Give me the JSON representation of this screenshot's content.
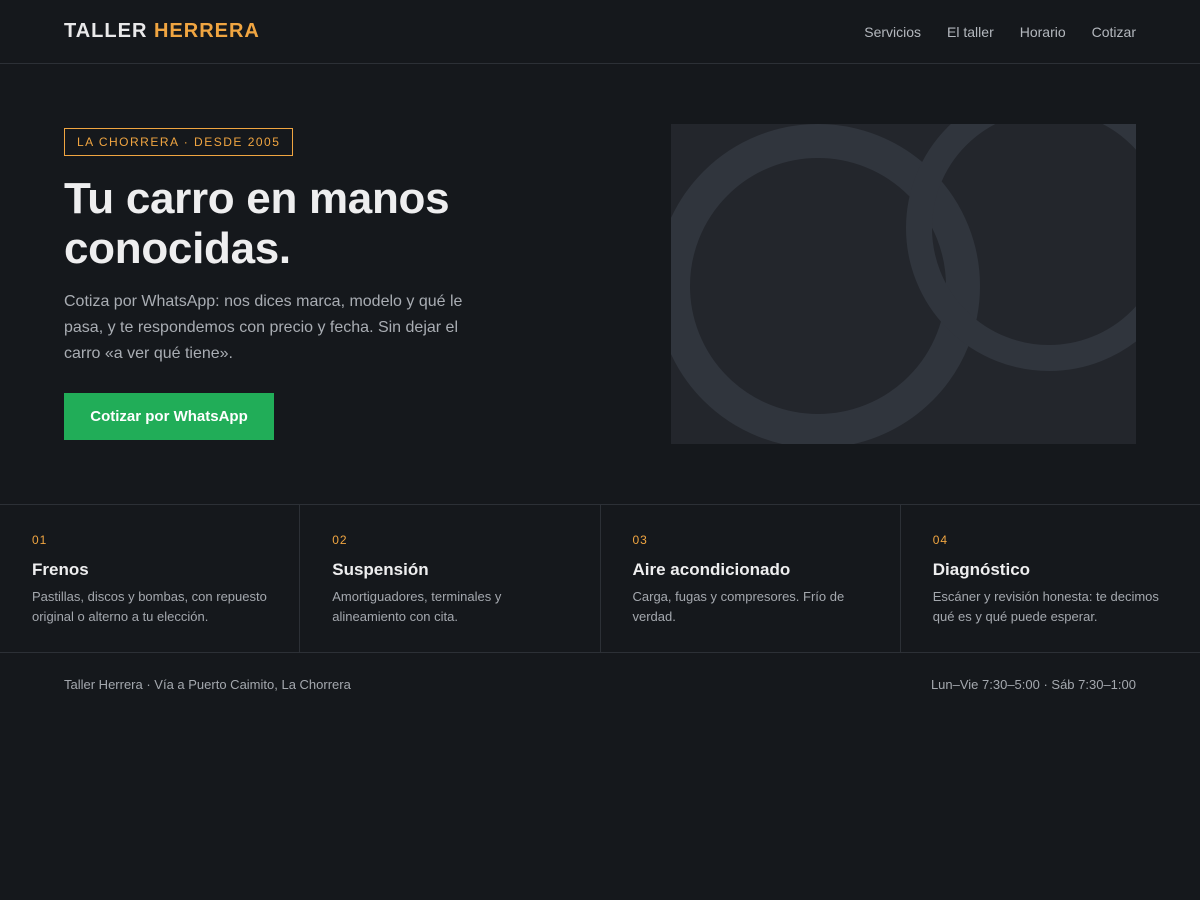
{
  "brand": {
    "part1": "TALLER",
    "part2": "HERRERA"
  },
  "nav": {
    "items": [
      "Servicios",
      "El taller",
      "Horario",
      "Cotizar"
    ]
  },
  "hero": {
    "tag": "LA CHORRERA · DESDE 2005",
    "title": "Tu carro en manos conocidas.",
    "text": "Cotiza por WhatsApp: nos dices marca, modelo y qué le pasa, y te respondemos con precio y fecha. Sin dejar el carro «a ver qué tiene».",
    "cta_label": "Cotizar por WhatsApp"
  },
  "services": [
    {
      "num": "01",
      "title": "Frenos",
      "desc": "Pastillas, discos y bombas, con repuesto original o alterno a tu elección."
    },
    {
      "num": "02",
      "title": "Suspensión",
      "desc": "Amortiguadores, terminales y alineamiento con cita."
    },
    {
      "num": "03",
      "title": "Aire acondicionado",
      "desc": "Carga, fugas y compresores. Frío de verdad."
    },
    {
      "num": "04",
      "title": "Diagnóstico",
      "desc": "Escáner y revisión honesta: te decimos qué es y qué puede esperar."
    }
  ],
  "footer": {
    "address": "Taller Herrera · Vía a Puerto Caimito, La Chorrera",
    "hours": "Lun–Vie 7:30–5:00 · Sáb 7:30–1:00"
  },
  "colors": {
    "background": "#15181c",
    "accent": "#f0a541",
    "cta": "#21ad58",
    "art_panel": "#23262c",
    "art_ring": "#30353d"
  }
}
